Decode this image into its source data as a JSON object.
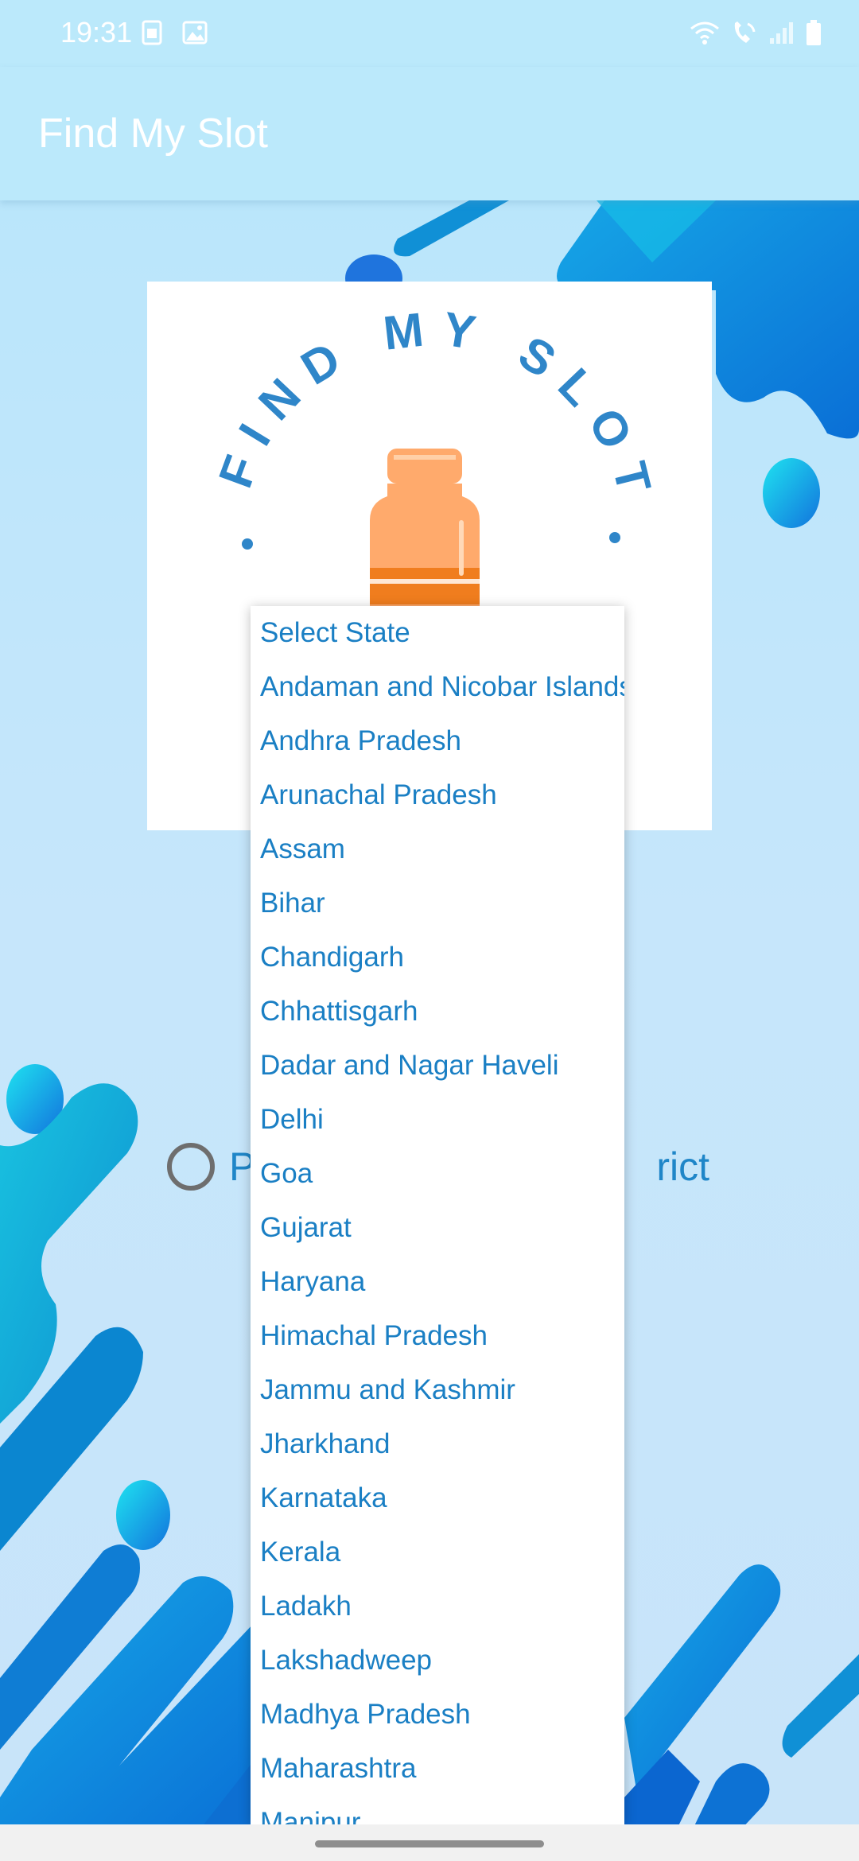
{
  "status_bar": {
    "time": "19:31",
    "left_icons": [
      "sim-card-icon",
      "image-icon"
    ],
    "right_icons": [
      "wifi-icon",
      "wifi-calling-icon",
      "signal-icon",
      "battery-icon"
    ]
  },
  "app_bar": {
    "title": "Find My Slot"
  },
  "logo": {
    "text": "FIND MY SLOT",
    "icon": "vaccine-bottle-icon",
    "colors": {
      "text": "#2f86c9",
      "bottle": "#ffaa6c",
      "band": "#f07d1e"
    }
  },
  "search_mode": {
    "option_visible_start": "P",
    "option_visible_end": "rict"
  },
  "state_dropdown": {
    "items": [
      "Select State",
      "Andaman and Nicobar Islands",
      "Andhra Pradesh",
      "Arunachal Pradesh",
      "Assam",
      "Bihar",
      "Chandigarh",
      "Chhattisgarh",
      "Dadar and Nagar Haveli",
      "Delhi",
      "Goa",
      "Gujarat",
      "Haryana",
      "Himachal Pradesh",
      "Jammu and Kashmir",
      "Jharkhand",
      "Karnataka",
      "Kerala",
      "Ladakh",
      "Lakshadweep",
      "Madhya Pradesh",
      "Maharashtra",
      "Manipur"
    ]
  },
  "theme": {
    "accent": "#1a7fc4",
    "app_bar_bg": "#bbe9fb"
  }
}
